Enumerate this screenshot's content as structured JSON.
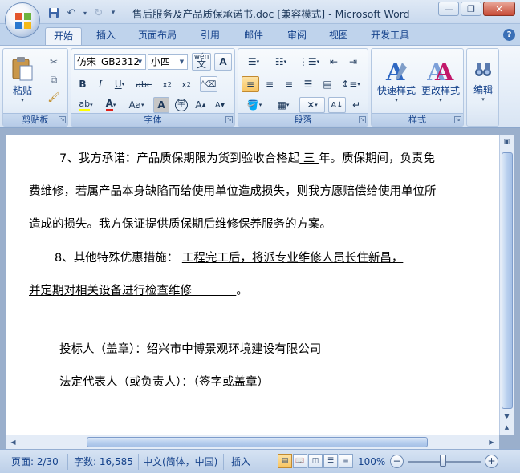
{
  "window": {
    "title": "售后服务及产品质保承诺书.doc [兼容模式] - Microsoft Word"
  },
  "tabs": [
    "开始",
    "插入",
    "页面布局",
    "引用",
    "邮件",
    "审阅",
    "视图",
    "开发工具"
  ],
  "ribbon": {
    "clipboard": {
      "label": "剪贴板",
      "paste": "粘贴"
    },
    "font": {
      "label": "字体",
      "font_name": "仿宋_GB2312",
      "font_size": "小四",
      "wen": "wén\n文"
    },
    "paragraph": {
      "label": "段落"
    },
    "styles": {
      "label": "样式",
      "quick_styles": "快速样式",
      "change_styles": "更改样式"
    },
    "editing": {
      "label": "编辑"
    }
  },
  "document": {
    "lines": [
      {
        "prefix": "7、我方承诺：产品质保期限为货到验收合格起",
        "underlined": " 三 ",
        "suffix": "年。质保期间，负责免"
      },
      {
        "text": "费维修，若属产品本身缺陷而给使用单位造成损失，则我方愿赔偿给使用单位所"
      },
      {
        "text": "造成的损失。我方保证提供质保期后维修保养服务的方案。"
      },
      {
        "prefix": "8、其他特殊优惠措施：  ",
        "underlined": "     工程完工后，将派专业维修人员长住新昌，"
      },
      {
        "underlined": "并定期对相关设备进行检查维修            ",
        "suffix": "。"
      },
      {
        "text": "投标人（盖章）：绍兴市中博景观环境建设有限公司"
      },
      {
        "text": "法定代表人（或负责人）：（签字或盖章）"
      }
    ]
  },
  "statusbar": {
    "page": "页面: 2/30",
    "words": "字数: 16,585",
    "language": "中文(简体，中国)",
    "mode": "插入",
    "zoom": "100%"
  }
}
